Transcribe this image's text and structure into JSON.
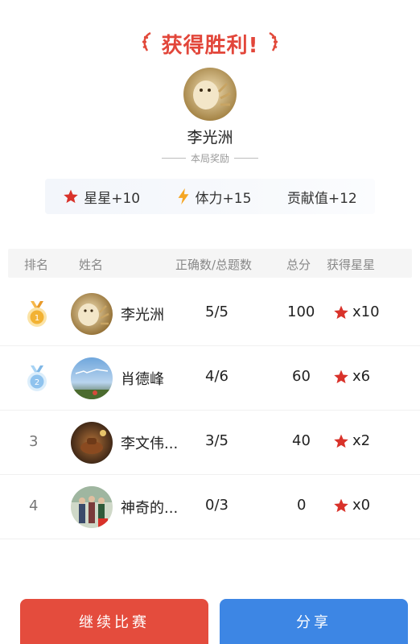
{
  "header": {
    "title": "获得胜利!"
  },
  "winner": {
    "name": "李光洲",
    "reward_caption": "本局奖励"
  },
  "rewards": [
    {
      "icon": "star-icon",
      "label": "星星+10"
    },
    {
      "icon": "lightning-icon",
      "label": "体力+15"
    },
    {
      "icon": "",
      "label": "贡献值+12"
    }
  ],
  "table": {
    "headers": {
      "rank": "排名",
      "name": "姓名",
      "correct": "正确数/总题数",
      "score": "总分",
      "stars": "获得星星"
    },
    "rows": [
      {
        "rank": "1",
        "name": "李光洲",
        "correct": "5/5",
        "score": "100",
        "stars": "x10"
      },
      {
        "rank": "2",
        "name": "肖德峰",
        "correct": "4/6",
        "score": "60",
        "stars": "x6"
      },
      {
        "rank": "3",
        "name": "李文伟...",
        "correct": "3/5",
        "score": "40",
        "stars": "x2"
      },
      {
        "rank": "4",
        "name": "神奇的...",
        "correct": "0/3",
        "score": "0",
        "stars": "x0"
      }
    ]
  },
  "buttons": {
    "continue": "继续比赛",
    "share": "分享"
  },
  "colors": {
    "title_red": "#e2463a",
    "star_red": "#d9322a",
    "bolt_orange": "#f5a623",
    "gold_medal": "#f2b233",
    "silver_medal": "#8fc3ee",
    "continue_button": "#e44c3d",
    "share_button": "#3d86e4"
  }
}
